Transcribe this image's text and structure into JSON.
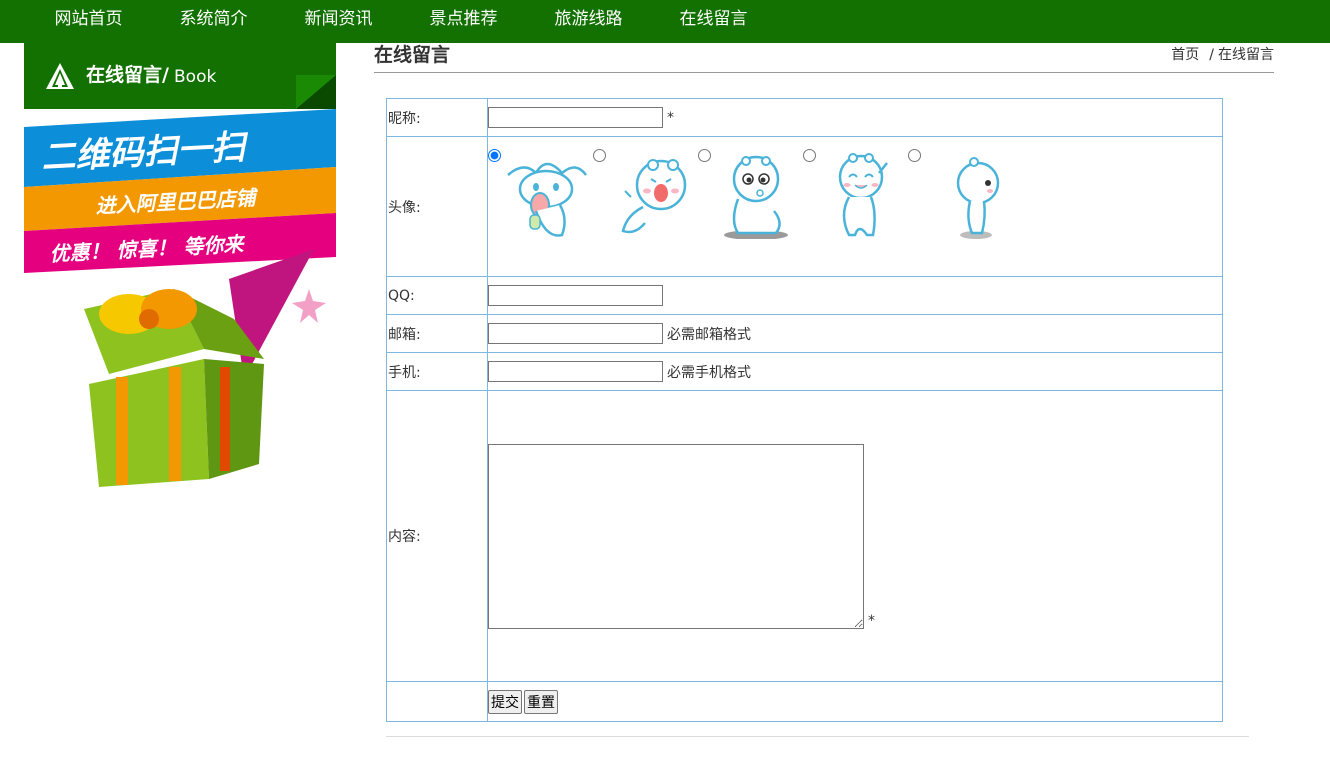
{
  "nav": [
    {
      "label": "网站首页"
    },
    {
      "label": "系统简介"
    },
    {
      "label": "新闻资讯"
    },
    {
      "label": "景点推荐"
    },
    {
      "label": "旅游线路"
    },
    {
      "label": "在线留言"
    }
  ],
  "sidebar": {
    "title_cn": "在线留言/",
    "title_en": "Book",
    "promo": {
      "line1": "二维码扫一扫",
      "line2": "进入阿里巴巴店铺",
      "line3": "优惠！ 惊喜！ 等你来"
    }
  },
  "page": {
    "title": "在线留言",
    "breadcrumb_home": "首页",
    "breadcrumb_sep": "/",
    "breadcrumb_current": "在线留言"
  },
  "form": {
    "nickname_label": "昵称:",
    "required_mark": "*",
    "avatar_label": "头像:",
    "avatar_selected_index": 0,
    "qq_label": "QQ:",
    "email_label": "邮箱:",
    "email_note": "必需邮箱格式",
    "phone_label": "手机:",
    "phone_note": "必需手机格式",
    "content_label": "内容:",
    "submit_label": "提交",
    "reset_label": "重置"
  },
  "colors": {
    "nav_bg": "#127100",
    "table_border": "#7eb8de",
    "promo_blue": "#0c8ed9",
    "promo_orange": "#f39800",
    "promo_pink": "#e5007f"
  },
  "icons": [
    "tree-logo-icon",
    "gift-box-icon",
    "mascot-avatar-icon"
  ]
}
